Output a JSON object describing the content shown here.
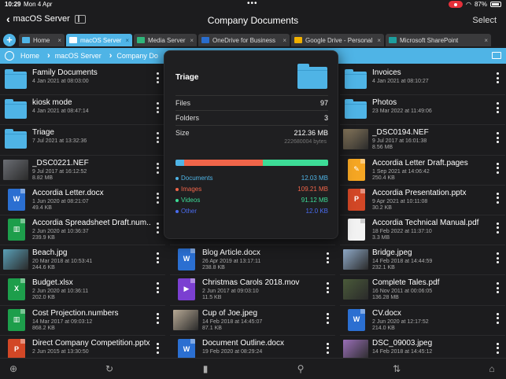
{
  "status": {
    "time": "10:29",
    "date": "Mon 4 Apr",
    "battery": "87%"
  },
  "nav": {
    "back_label": "macOS Server",
    "title": "Company Documents",
    "select_label": "Select"
  },
  "tabs": [
    {
      "label": "Home",
      "color": "#4fb4e6",
      "active": false
    },
    {
      "label": "macOS Server",
      "color": "#4fb4e6",
      "active": true
    },
    {
      "label": "Media Server",
      "color": "#2fb57a",
      "active": false
    },
    {
      "label": "OneDrive for Business",
      "color": "#2b6fd1",
      "active": false
    },
    {
      "label": "Google Drive - Personal",
      "color": "#f4b400",
      "active": false
    },
    {
      "label": "Microsoft SharePoint",
      "color": "#1d9e9e",
      "active": false
    }
  ],
  "path": {
    "crumbs": [
      "Home",
      "macOS Server",
      "Company Do"
    ]
  },
  "columns": [
    [
      {
        "name": "Family Documents",
        "meta1": "4 Jan 2021 at 08:03:00",
        "meta2": "",
        "kind": "folder"
      },
      {
        "name": "kiosk mode",
        "meta1": "4 Jan 2021 at 08:47:14",
        "meta2": "",
        "kind": "folder"
      },
      {
        "name": "Triage",
        "meta1": "7 Jul 2021 at 13:32:36",
        "meta2": "",
        "kind": "folder"
      },
      {
        "name": "_DSC0221.NEF",
        "meta1": "9 Jul 2017 at 16:12:52",
        "meta2": "8.82 MB",
        "kind": "photo",
        "color": "#6b6e74"
      },
      {
        "name": "Accordia Letter.docx",
        "meta1": "1 Jun 2020 at 08:21:07",
        "meta2": "49.4 KB",
        "kind": "word",
        "glyph": "W"
      },
      {
        "name": "Accordia Spreadsheet Draft.num...",
        "meta1": "2 Jun 2020 at 10:36:37",
        "meta2": "239.9 KB",
        "kind": "excel",
        "glyph": "▥"
      },
      {
        "name": "Beach.jpg",
        "meta1": "20 Mar 2018 at 10:53:41",
        "meta2": "244.6 KB",
        "kind": "photo",
        "color": "#5aa0b8"
      },
      {
        "name": "Budget.xlsx",
        "meta1": "2 Jun 2020 at 10:36:11",
        "meta2": "202.0 KB",
        "kind": "excel",
        "glyph": "X"
      },
      {
        "name": "Cost Projection.numbers",
        "meta1": "14 Mar 2017 at 09:03:12",
        "meta2": "868.2 KB",
        "kind": "excel",
        "glyph": "▥"
      },
      {
        "name": "Direct Company Competition.pptx",
        "meta1": "2 Jun 2015 at 13:30:50",
        "meta2": "",
        "kind": "ppt",
        "glyph": "P"
      }
    ],
    [
      {
        "name": "",
        "meta1": "",
        "meta2": "",
        "kind": "hidden"
      },
      {
        "name": "",
        "meta1": "",
        "meta2": "",
        "kind": "hidden"
      },
      {
        "name": "",
        "meta1": "",
        "meta2": "",
        "kind": "hidden"
      },
      {
        "name": "",
        "meta1": "",
        "meta2": "",
        "kind": "hidden"
      },
      {
        "name": "",
        "meta1": "",
        "meta2": "",
        "kind": "hidden"
      },
      {
        "name": "",
        "meta1": "",
        "meta2": "",
        "kind": "hidden"
      },
      {
        "name": "Blog Article.docx",
        "meta1": "26 Apr 2019 at 13:17:11",
        "meta2": "238.8 KB",
        "kind": "word",
        "glyph": "W"
      },
      {
        "name": "Christmas Carols 2018.mov",
        "meta1": "2 Jun 2017 at 09:03:10",
        "meta2": "11.5 KB",
        "kind": "mov",
        "glyph": "▶"
      },
      {
        "name": "Cup of Joe.jpeg",
        "meta1": "14 Feb 2018 at 14:45:07",
        "meta2": "87.1 KB",
        "kind": "photo",
        "color": "#b7a995"
      },
      {
        "name": "Document Outline.docx",
        "meta1": "19 Feb 2020 at 08:29:24",
        "meta2": "",
        "kind": "word",
        "glyph": "W"
      }
    ],
    [
      {
        "name": "Invoices",
        "meta1": "4 Jan 2021 at 08:10:27",
        "meta2": "",
        "kind": "folder"
      },
      {
        "name": "Photos",
        "meta1": "23 Mar 2022 at 11:49:06",
        "meta2": "",
        "kind": "folder"
      },
      {
        "name": "_DSC0194.NEF",
        "meta1": "9 Jul 2017 at 16:01:38",
        "meta2": "8.56 MB",
        "kind": "photo",
        "color": "#8a7a5e"
      },
      {
        "name": "Accordia Letter Draft.pages",
        "meta1": "1 Sep 2021 at 14:06:42",
        "meta2": "250.4 KB",
        "kind": "pages",
        "glyph": "✎"
      },
      {
        "name": "Accordia Presentation.pptx",
        "meta1": "9 Apr 2021 at 10:11:08",
        "meta2": "30.2 KB",
        "kind": "ppt",
        "glyph": "P"
      },
      {
        "name": "Accordia Technical Manual.pdf",
        "meta1": "18 Feb 2022 at 11:37:10",
        "meta2": "3.3 MB",
        "kind": "pdf",
        "glyph": ""
      },
      {
        "name": "Bridge.jpeg",
        "meta1": "14 Feb 2018 at 14:44:59",
        "meta2": "232.1 KB",
        "kind": "photo",
        "color": "#8faac8"
      },
      {
        "name": "Complete Tales.pdf",
        "meta1": "16 Nov 2011 at 00:06:05",
        "meta2": "136.28 MB",
        "kind": "photo",
        "color": "#4a5a3a"
      },
      {
        "name": "CV.docx",
        "meta1": "2 Jun 2020 at 12:17:52",
        "meta2": "214.0 KB",
        "kind": "word",
        "glyph": "W"
      },
      {
        "name": "DSC_09003.jpeg",
        "meta1": "14 Feb 2018 at 14:45:12",
        "meta2": "",
        "kind": "photo",
        "color": "#9a6fb8"
      }
    ]
  ],
  "popover": {
    "title": "Triage",
    "files_label": "Files",
    "files_value": "97",
    "folders_label": "Folders",
    "folders_value": "3",
    "size_label": "Size",
    "size_value": "212.36 MB",
    "size_bytes": "222680004 bytes",
    "breakdown": [
      {
        "label": "Documents",
        "value": "12.03 MB",
        "fraction": 0.057,
        "color": "#4fb4e6"
      },
      {
        "label": "Images",
        "value": "109.21 MB",
        "fraction": 0.514,
        "color": "#f0654a"
      },
      {
        "label": "Videos",
        "value": "91.12 MB",
        "fraction": 0.429,
        "color": "#3ddc97"
      },
      {
        "label": "Other",
        "value": "12.0 KB",
        "fraction": 0.002,
        "color": "#4a6cf0"
      }
    ]
  }
}
